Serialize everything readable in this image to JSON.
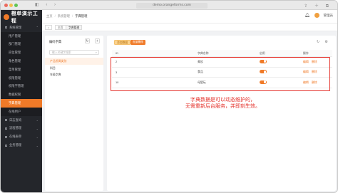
{
  "browser": {
    "url": "demo.orangeforms.com"
  },
  "app": {
    "title": "橙单演示工程"
  },
  "sidebar": {
    "items": [
      {
        "label": "系统管理",
        "level": "top",
        "expanded": true
      },
      {
        "label": "用户管理",
        "level": "sub"
      },
      {
        "label": "部门管理",
        "level": "sub"
      },
      {
        "label": "岗位管理",
        "level": "sub"
      },
      {
        "label": "角色管理",
        "level": "sub"
      },
      {
        "label": "菜单管理",
        "level": "sub"
      },
      {
        "label": "权限管理",
        "level": "sub"
      },
      {
        "label": "权限字管理",
        "level": "sub"
      },
      {
        "label": "数据权限",
        "level": "sub"
      },
      {
        "label": "字典管理",
        "level": "sub",
        "active": true
      },
      {
        "label": "在线用户",
        "level": "sub"
      },
      {
        "label": "日志查询",
        "level": "top"
      },
      {
        "label": "流程管理",
        "level": "top"
      },
      {
        "label": "在线表单",
        "level": "top"
      },
      {
        "label": "业务管理",
        "level": "top"
      }
    ]
  },
  "header": {
    "breadcrumbs": [
      "主页",
      "系统管理",
      "字典管理"
    ],
    "user": "管理员"
  },
  "tabs": [
    {
      "label": "主页"
    },
    {
      "label": "字典管理",
      "active": true
    }
  ],
  "dict_panel": {
    "title": "编码字典",
    "search_placeholder": "输入关键字搜索",
    "items": [
      {
        "label": "产品所属类别",
        "active": true
      },
      {
        "label": "科目"
      },
      {
        "label": "年级字典"
      }
    ]
  },
  "data_panel": {
    "add_label": "添加数据",
    "delete_label": "批量删除",
    "columns": [
      "ID",
      "字典名称",
      "启用",
      "操作"
    ],
    "rows": [
      {
        "id": "2",
        "name": "美妆",
        "enabled": true,
        "edit": "编辑",
        "delete": "删除"
      },
      {
        "id": "3",
        "name": "食品",
        "enabled": true,
        "edit": "编辑",
        "delete": "删除"
      },
      {
        "id": "10",
        "name": "母婴玩",
        "enabled": true,
        "edit": "编辑",
        "delete": "删除"
      }
    ]
  },
  "annotation": {
    "line1": "字典数据是可以动态维护的，",
    "line2": "无需重新后台服务，并即刻生效。"
  },
  "colors": {
    "accent": "#f07a28",
    "sidebar": "#24262b",
    "highlight": "#e4312a"
  }
}
